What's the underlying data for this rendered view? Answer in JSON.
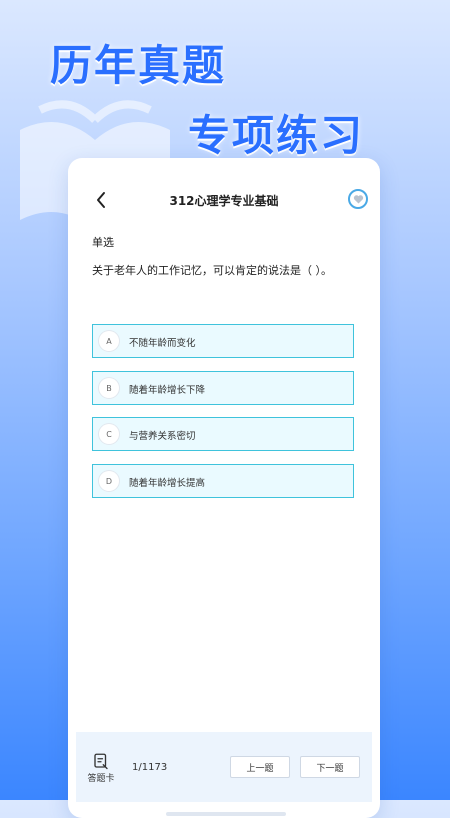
{
  "promo": {
    "line1": "历年真题",
    "line2": "专项练习"
  },
  "header": {
    "title": "312心理学专业基础"
  },
  "question": {
    "type": "单选",
    "text": "关于老年人的工作记忆，可以肯定的说法是（ ）。",
    "options": [
      {
        "letter": "A",
        "text": "不随年龄而变化"
      },
      {
        "letter": "B",
        "text": "随着年龄增长下降"
      },
      {
        "letter": "C",
        "text": "与营养关系密切"
      },
      {
        "letter": "D",
        "text": "随着年龄增长提高"
      }
    ]
  },
  "footer": {
    "answer_card_label": "答题卡",
    "progress": "1/1173",
    "prev_label": "上一题",
    "next_label": "下一题"
  },
  "colors": {
    "accent": "#2a6fff",
    "option_border": "#3fc3dc",
    "option_bg": "#eafaff"
  }
}
